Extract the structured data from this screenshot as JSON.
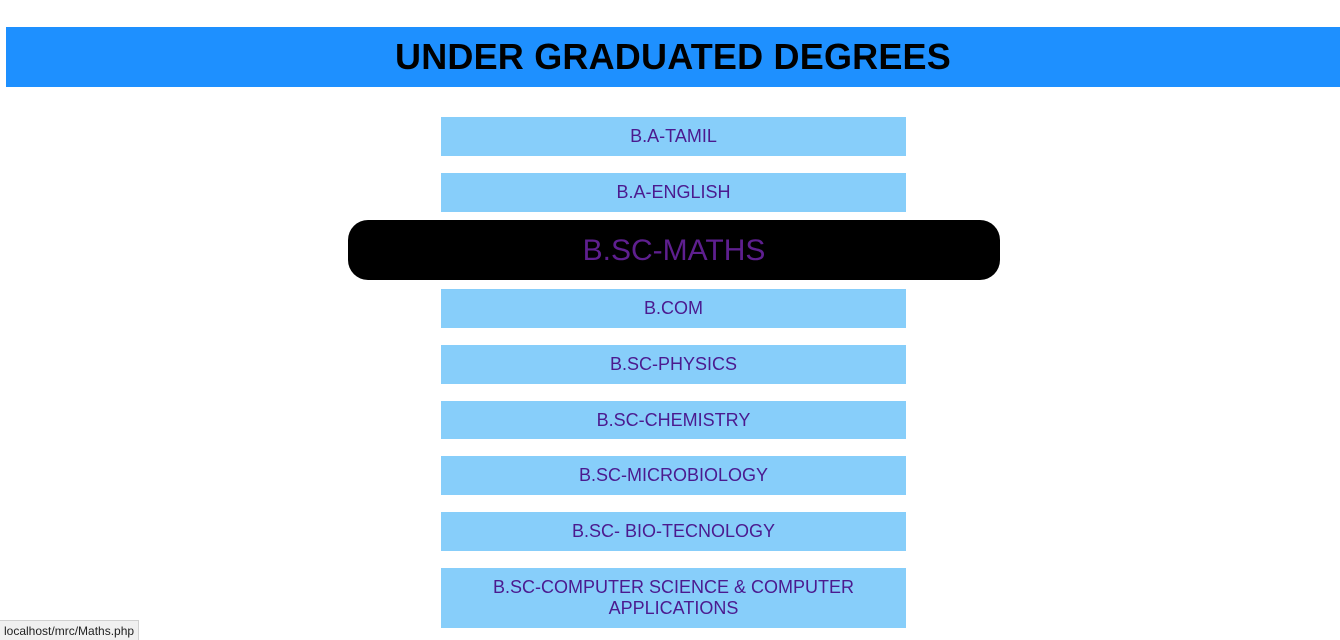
{
  "header": {
    "title": "UNDER GRADUATED DEGREES"
  },
  "degrees": [
    {
      "label": "B.A-TAMIL"
    },
    {
      "label": "B.A-ENGLISH"
    },
    {
      "label": "B.SC-MATHS",
      "hovered": true
    },
    {
      "label": "B.COM"
    },
    {
      "label": "B.SC-PHYSICS"
    },
    {
      "label": "B.SC-CHEMISTRY"
    },
    {
      "label": "B.SC-MICROBIOLOGY"
    },
    {
      "label": "B.SC- BIO-TECNOLOGY"
    },
    {
      "label": "B.SC-COMPUTER SCIENCE & COMPUTER APPLICATIONS"
    }
  ],
  "status_bar": {
    "url": "localhost/mrc/Maths.php"
  },
  "colors": {
    "header_bg": "#1e90ff",
    "link_bg": "#87cefa",
    "link_text": "#4b1a8f",
    "hover_bg": "#000000"
  }
}
